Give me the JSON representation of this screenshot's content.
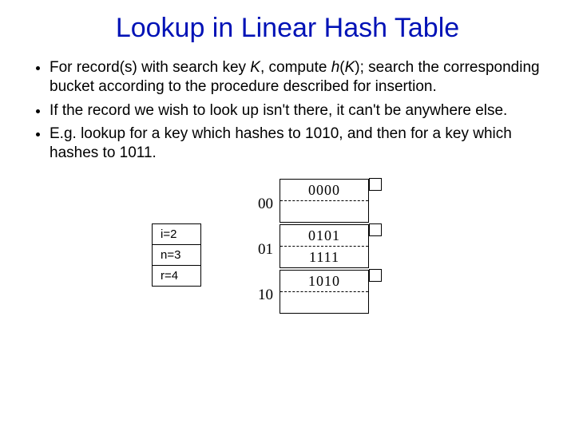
{
  "title": "Lookup in Linear Hash Table",
  "bullets": [
    "For record(s) with search key K, compute h(K); search the corresponding bucket according to the procedure described for insertion.",
    "If the record we wish to look up isn't there, it can't be anywhere else.",
    "E.g. lookup for a key which hashes to 1010, and then for a key which hashes to 1011."
  ],
  "params": {
    "i": "i=2",
    "n": "n=3",
    "r": "r=4"
  },
  "buckets": [
    {
      "label": "00",
      "slots": [
        "0000",
        ""
      ]
    },
    {
      "label": "01",
      "slots": [
        "0101",
        "1111"
      ]
    },
    {
      "label": "10",
      "slots": [
        "1010",
        ""
      ]
    }
  ]
}
